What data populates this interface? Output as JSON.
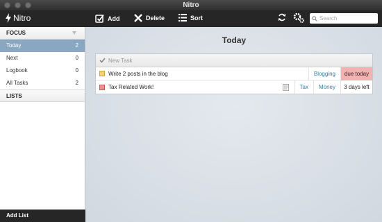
{
  "window": {
    "title": "Nitro"
  },
  "toolbar": {
    "brand": "Nitro",
    "add_label": "Add",
    "delete_label": "Delete",
    "sort_label": "Sort",
    "search_placeholder": "Search"
  },
  "sidebar": {
    "focus_header": "FOCUS",
    "items": [
      {
        "label": "Today",
        "count": "2",
        "active": true
      },
      {
        "label": "Next",
        "count": "0",
        "active": false
      },
      {
        "label": "Logbook",
        "count": "0",
        "active": false
      },
      {
        "label": "All Tasks",
        "count": "2",
        "active": false
      }
    ],
    "lists_header": "LISTS",
    "add_list_label": "Add List"
  },
  "main": {
    "title": "Today",
    "new_task_placeholder": "New Task",
    "tasks": [
      {
        "name": "Write 2 posts in the blog",
        "priority_color": "#f5d26a",
        "tags": [
          "Blogging"
        ],
        "due": "due today",
        "has_note": false
      },
      {
        "name": "Tax Related Work!",
        "priority_color": "#ef8c8c",
        "tags": [
          "Tax",
          "Money"
        ],
        "due": "3 days left",
        "has_note": true
      }
    ]
  },
  "colors": {
    "accent": "#8aa7c2",
    "toolbar": "#262626",
    "tag": "#2f7fa3",
    "overdue": "#f3b2b2"
  }
}
